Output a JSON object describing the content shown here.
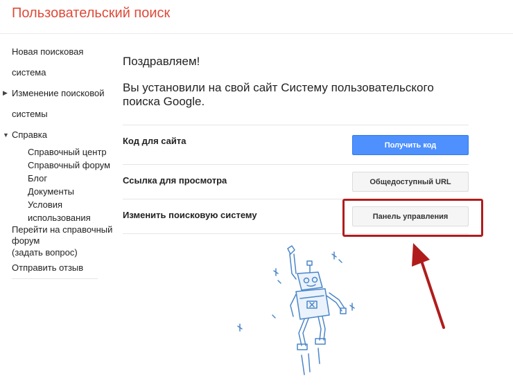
{
  "header": {
    "title": "Пользовательский поиск"
  },
  "sidebar": {
    "new_engine": {
      "line1": "Новая поисковая",
      "line2": "система"
    },
    "edit_engine": {
      "line1": "Изменение поисковой",
      "line2": "системы"
    },
    "help": {
      "label": "Справка",
      "items": [
        "Справочный центр",
        "Справочный форум",
        "Блог",
        "Документы",
        "Условия",
        "использования"
      ]
    },
    "forum_link": {
      "line1": "Перейти на справочный",
      "line2": "форум",
      "line3": "(задать вопрос)"
    },
    "feedback": "Отправить отзыв"
  },
  "main": {
    "congrats": "Поздравляем!",
    "installed_line1": "Вы установили на свой сайт Систему пользовательского",
    "installed_line2": "поиска Google.",
    "rows": [
      {
        "label": "Код для сайта",
        "button": "Получить код"
      },
      {
        "label": "Ссылка для просмотра",
        "button": "Общедоступный URL"
      },
      {
        "label": "Изменить поисковую систему",
        "button": "Панель управления"
      }
    ]
  },
  "colors": {
    "title": "#dd4b39",
    "primary_button": "#4d90fe",
    "annotation": "#b01c1c",
    "robot": "#4a86c8"
  },
  "icons": [
    "triangle-right-icon",
    "triangle-down-icon",
    "robot-illustration",
    "annotation-arrow"
  ]
}
